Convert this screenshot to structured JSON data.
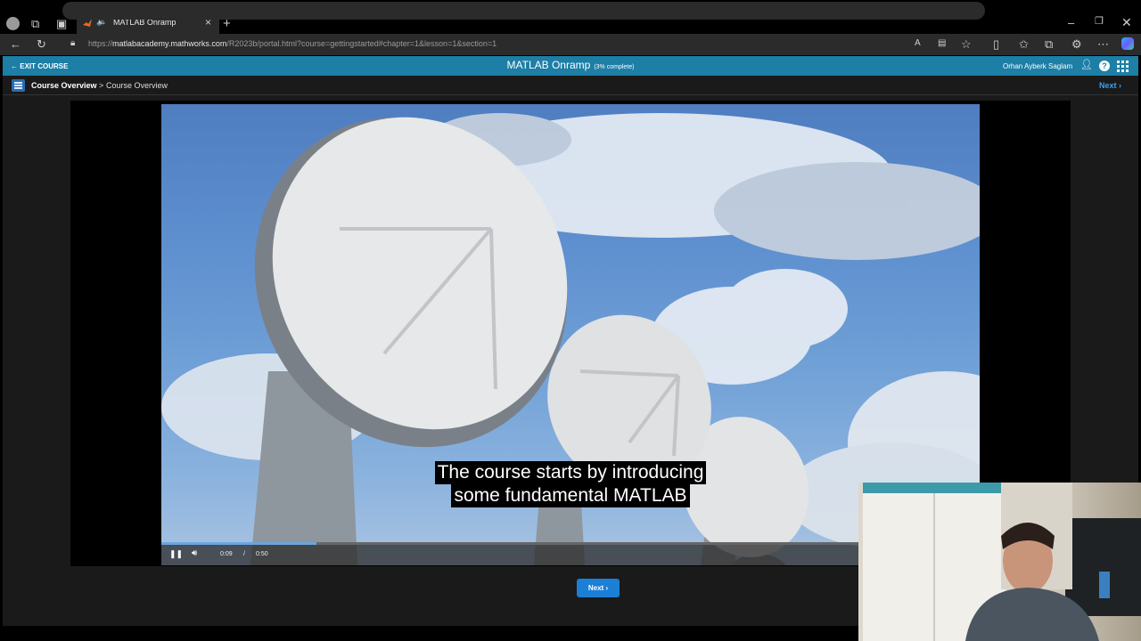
{
  "browser": {
    "tab_title": "MATLAB Onramp",
    "url_prefix": "https://",
    "url_host": "matlabacademy.mathworks.com",
    "url_path": "/R2023b/portal.html?course=gettingstarted#chapter=1&lesson=1&section=1"
  },
  "course": {
    "exit_label": "EXIT COURSE",
    "title": "MATLAB Onramp",
    "progress": "(3% complete)",
    "user": "Orhan Ayberk Saglam"
  },
  "breadcrumb": {
    "section": "Course Overview",
    "separator": ">",
    "page": "Course Overview",
    "next_label": "Next"
  },
  "video": {
    "caption_line1": "The course starts by introducing",
    "caption_line2": "some fundamental MATLAB",
    "current_time": "0:09",
    "time_separator": "/",
    "duration": "0:50",
    "progress_fraction": 0.19
  },
  "footer": {
    "next_label": "Next"
  },
  "colors": {
    "header": "#1d7ea6",
    "accent": "#1b7fd6"
  }
}
